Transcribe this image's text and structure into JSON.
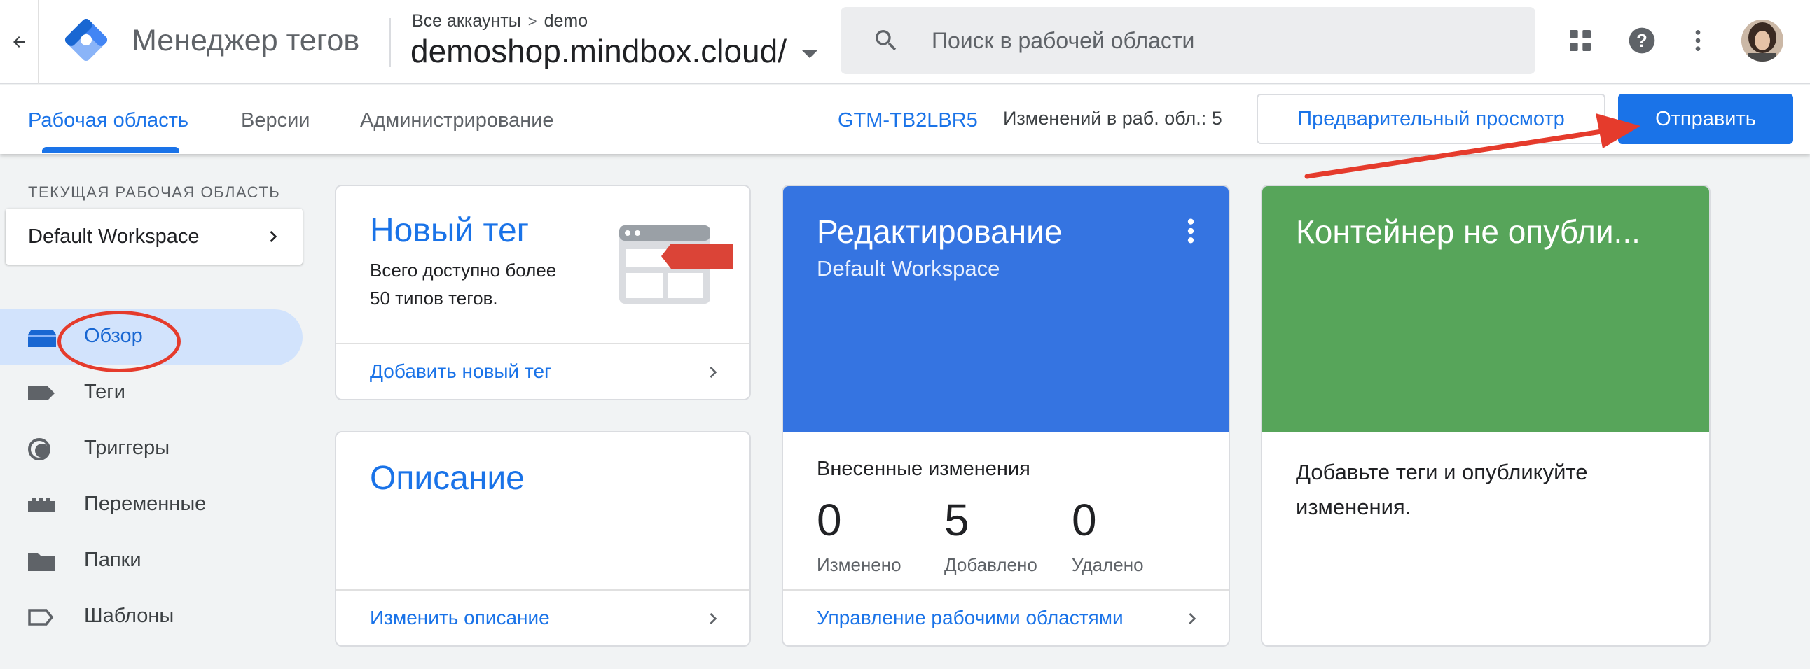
{
  "header": {
    "product_name": "Менеджер тегов",
    "breadcrumb": {
      "accounts": "Все аккаунты",
      "separator": ">",
      "account": "demo"
    },
    "container_name": "demoshop.mindbox.cloud/",
    "search_placeholder": "Поиск в рабочей области",
    "icons": [
      "back-arrow-icon",
      "gtm-logo",
      "search-icon",
      "apps-grid-icon",
      "help-icon",
      "more-vert-icon",
      "avatar"
    ]
  },
  "subnav": {
    "tabs": [
      {
        "label": "Рабочая область",
        "active": true
      },
      {
        "label": "Версии",
        "active": false
      },
      {
        "label": "Администрирование",
        "active": false
      }
    ],
    "container_id": "GTM-TB2LBR5",
    "workspace_changes": "Изменений в раб. обл.: 5",
    "preview_label": "Предварительный просмотр",
    "submit_label": "Отправить"
  },
  "sidebar": {
    "workspace_heading": "ТЕКУЩАЯ РАБОЧАЯ ОБЛАСТЬ",
    "workspace_name": "Default Workspace",
    "items": [
      {
        "label": "Обзор",
        "icon": "overview-icon",
        "active": true
      },
      {
        "label": "Теги",
        "icon": "tag-icon",
        "active": false
      },
      {
        "label": "Триггеры",
        "icon": "trigger-icon",
        "active": false
      },
      {
        "label": "Переменные",
        "icon": "variables-icon",
        "active": false
      },
      {
        "label": "Папки",
        "icon": "folder-icon",
        "active": false
      },
      {
        "label": "Шаблоны",
        "icon": "template-icon",
        "active": false
      }
    ]
  },
  "cards": {
    "new_tag": {
      "title": "Новый тег",
      "body": "Всего доступно более 50 типов тегов.",
      "link": "Добавить новый тег"
    },
    "description": {
      "title": "Описание",
      "link": "Изменить описание"
    },
    "editing": {
      "title": "Редактирование",
      "subtitle": "Default Workspace",
      "changes_heading": "Внесенные изменения",
      "stats": [
        {
          "value": "0",
          "label": "Изменено"
        },
        {
          "value": "5",
          "label": "Добавлено"
        },
        {
          "value": "0",
          "label": "Удалено"
        }
      ],
      "link": "Управление рабочими областями"
    },
    "publish": {
      "title": "Контейнер не опубли...",
      "body": "Добавьте теги и опубликуйте изменения."
    }
  },
  "colors": {
    "accent": "#1a73e8",
    "editing_card": "#3574e1",
    "publish_card": "#57a55a",
    "annotation": "#e53b2c"
  }
}
